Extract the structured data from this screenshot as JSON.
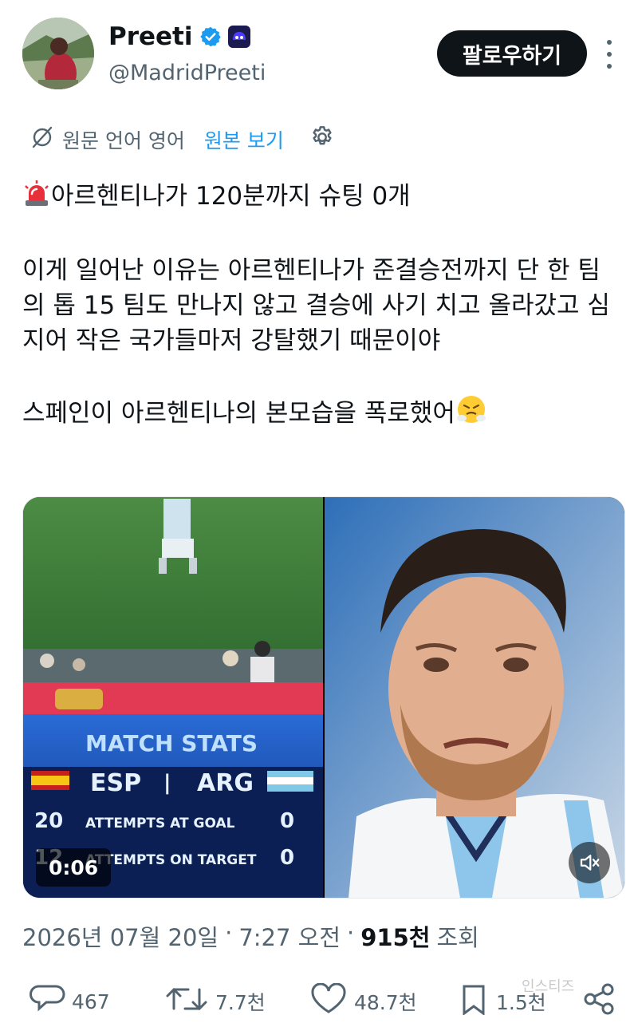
{
  "user": {
    "name": "Preeti",
    "handle": "@MadridPreeti",
    "follow_label": "팔로우하기"
  },
  "translate": {
    "source_label": "원문 언어 영어",
    "show_original": "원본 보기"
  },
  "tweet": {
    "line1": "아르헨티나가 120분까지 슈팅 0개",
    "para2": "이게 일어난 이유는 아르헨티나가 준결승전까지 단 한 팀의 톱 15 팀도 만나지 않고 결승에 사기 치고 올라갔고 심지어 작은 국가들마저 강탈했기 때문이야",
    "para3": "스페인이 아르헨티나의 본모습을 폭로했어"
  },
  "media": {
    "duration": "0:06",
    "stats_title": "MATCH STATS",
    "team_left": "ESP",
    "team_right": "ARG",
    "row1_left": "20",
    "row1_label": "ATTEMPTS AT GOAL",
    "row1_right": "0",
    "row2_left": "12",
    "row2_label": "ATTEMPTS ON TARGET",
    "row2_right": "0"
  },
  "meta": {
    "date": "2026년 07월 20일",
    "time": "7:27 오전",
    "views_count": "915천",
    "views_label": "조회"
  },
  "actions": {
    "replies": "467",
    "reposts": "7.7천",
    "likes": "48.7천",
    "bookmarks": "1.5천"
  },
  "watermark": "인스티즈",
  "colors": {
    "link": "#1d9bf0",
    "secondary": "#536471",
    "follow_bg": "#0f1419"
  }
}
